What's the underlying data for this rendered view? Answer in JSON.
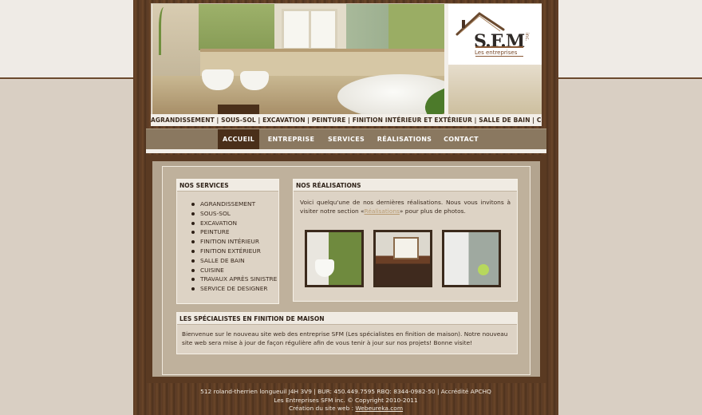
{
  "logo": {
    "brand": "S.F.M",
    "suffix": "inc.",
    "subtitle": "Les entreprises"
  },
  "service_strip": "AGRANDISSEMENT | SOUS-SOL | EXCAVATION | PEINTURE | FINITION INTÉRIEUR ET EXTÉRIEUR | SALLE DE BAIN | CUISINE",
  "nav": [
    {
      "label": "ACCUEIL",
      "active": true
    },
    {
      "label": "ENTREPRISE"
    },
    {
      "label": "SERVICES"
    },
    {
      "label": "RÉALISATIONS"
    },
    {
      "label": "CONTACT"
    }
  ],
  "services_box": {
    "title": "NOS SERVICES",
    "items": [
      "AGRANDISSEMENT",
      "SOUS-SOL",
      "EXCAVATION",
      "PEINTURE",
      "FINITION INTÉRIEUR",
      "FINITION EXTÉRIEUR",
      "SALLE DE BAIN",
      "CUISINE",
      "TRAVAUX APRÈS SINISTRE",
      "SERVICE DE DESIGNER"
    ]
  },
  "realisations_box": {
    "title": "NOS RÉALISATIONS",
    "text_before": "Voici quelqu'une de nos dernières réalisations. Nous vous invitons à visiter notre section «",
    "link": "Réalisations",
    "text_after": "» pour plus de photos."
  },
  "welcome_box": {
    "title": "LES SPÉCIALISTES EN FINITION DE MAISON",
    "text": "Bienvenue sur le nouveau site web des entreprise SFM (Les spécialistes en finition de maison). Notre nouveau site web sera mise à jour de façon régulière afin de vous tenir à jour sur nos projets! Bonne visite!"
  },
  "footer": {
    "line1": "512 roland-therrien longueuil J4H 3V9 | BUR: 450.449.7595 RBQ: 8344-0982-50 | Accrédité APCHQ",
    "line2": "Les Entreprises SFM inc. © Copyright 2010-2011",
    "line3_prefix": "Création du site web : ",
    "line3_link": "Webeureka.com"
  }
}
